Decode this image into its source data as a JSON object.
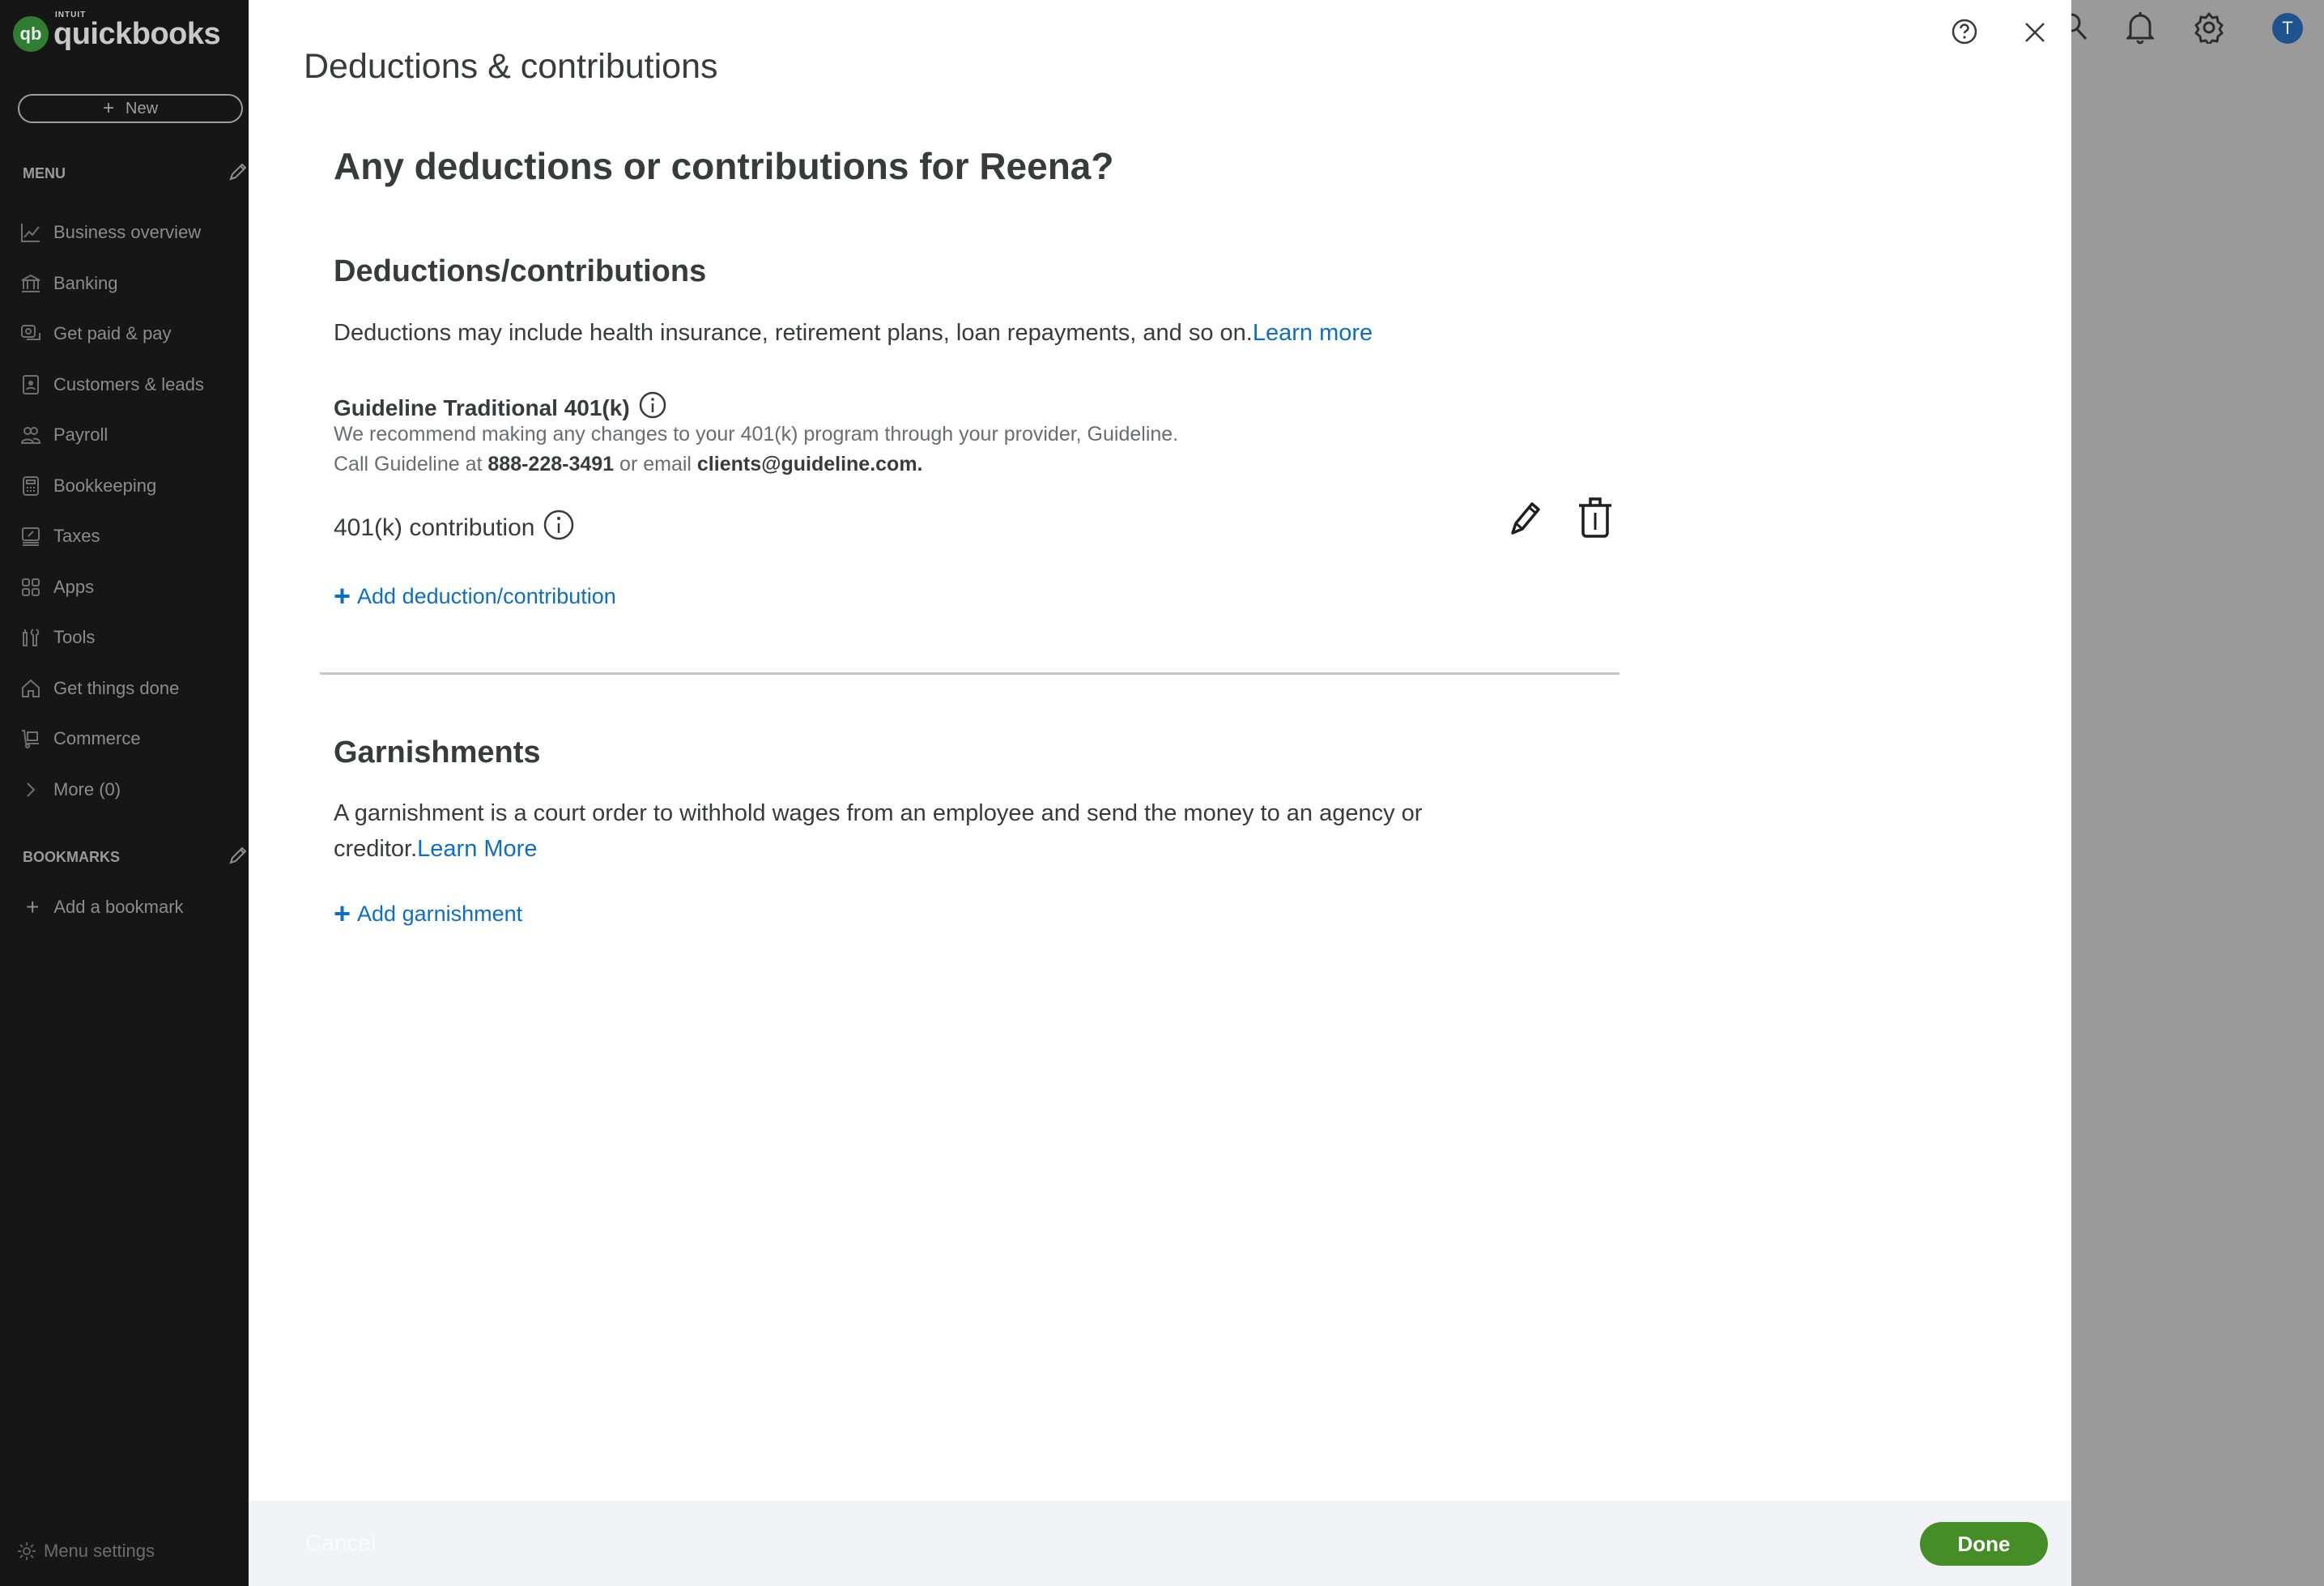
{
  "app": {
    "brand_small": "INTUIT",
    "brand": "quickbooks",
    "logo_mark": "qb"
  },
  "sidebar": {
    "new_button": "New",
    "menu_label": "MENU",
    "items": [
      {
        "label": "Business overview",
        "icon": "chart-line-icon"
      },
      {
        "label": "Banking",
        "icon": "bank-icon"
      },
      {
        "label": "Get paid & pay",
        "icon": "payment-icon"
      },
      {
        "label": "Customers & leads",
        "icon": "contacts-icon"
      },
      {
        "label": "Payroll",
        "icon": "people-icon"
      },
      {
        "label": "Bookkeeping",
        "icon": "calculator-icon"
      },
      {
        "label": "Taxes",
        "icon": "tax-icon"
      },
      {
        "label": "Apps",
        "icon": "apps-grid-icon"
      },
      {
        "label": "Tools",
        "icon": "tools-icon"
      },
      {
        "label": "Get things done",
        "icon": "home-icon"
      },
      {
        "label": "Commerce",
        "icon": "cart-icon"
      },
      {
        "label": "More (0)",
        "icon": "chevron-right-icon"
      }
    ],
    "bookmarks_label": "BOOKMARKS",
    "add_bookmark": "Add a bookmark",
    "menu_settings": "Menu settings"
  },
  "topbar": {
    "avatar_initial": "T"
  },
  "panel": {
    "title": "Deductions & contributions",
    "heading": "Any deductions or contributions for Reena?",
    "deductions": {
      "heading": "Deductions/contributions",
      "description": "Deductions may include health insurance, retirement plans, loan repayments, and so on.",
      "learn_more": "Learn more",
      "plan_name": "Guideline Traditional 401(k)",
      "plan_desc_line1": "We recommend making any changes to your 401(k) program through your provider, Guideline.",
      "plan_desc_prefix": "Call Guideline at ",
      "plan_phone": "888-228-3491",
      "plan_desc_middle": " or email ",
      "plan_email": "clients@guideline.com.",
      "item_label": "401(k) contribution",
      "add_label": "Add deduction/contribution"
    },
    "garnishments": {
      "heading": "Garnishments",
      "description_line1": "A garnishment is a court order to withhold wages from an employee and send the money to an agency or",
      "description_line2": "creditor.",
      "learn_more": "Learn More",
      "add_label": "Add garnishment"
    },
    "footer": {
      "cancel": "Cancel",
      "done": "Done"
    }
  },
  "colors": {
    "accent_link": "#0d6fc4",
    "done_button": "#458e27",
    "sidebar_bg": "#161616",
    "avatar_bg": "#1f5390"
  }
}
